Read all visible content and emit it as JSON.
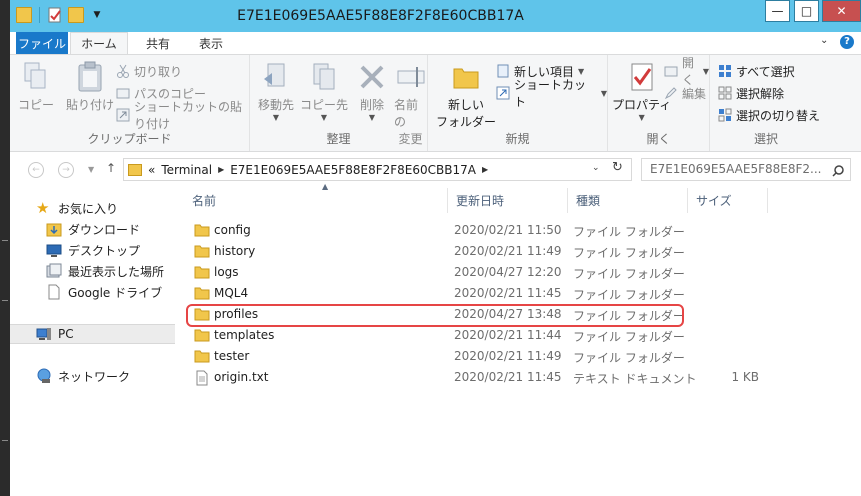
{
  "window": {
    "title": "E7E1E069E5AAE5F88E8F2F8E60CBB17A",
    "min_label": "—",
    "max_label": "□",
    "close_label": "✕"
  },
  "tabs": {
    "file": "ファイル",
    "home": "ホーム",
    "share": "共有",
    "view": "表示"
  },
  "ribbon": {
    "clipboard": {
      "label": "クリップボード",
      "copy": "コピー",
      "paste": "貼り付け",
      "cut": "切り取り",
      "copy_path": "パスのコピー",
      "paste_shortcut": "ショートカットの貼り付け"
    },
    "organize": {
      "label": "整理",
      "move_to": "移動先",
      "copy_to": "コピー先",
      "delete": "削除",
      "rename_line1": "名前の",
      "rename_line2": "変更"
    },
    "new": {
      "label": "新規",
      "new_folder_line1": "新しい",
      "new_folder_line2": "フォルダー",
      "new_item": "新しい項目",
      "shortcut": "ショートカット"
    },
    "open": {
      "label": "開く",
      "properties": "プロパティ",
      "open": "開く",
      "edit": "編集"
    },
    "select": {
      "label": "選択",
      "select_all": "すべて選択",
      "select_none": "選択解除",
      "invert": "選択の切り替え"
    }
  },
  "address": {
    "prefix": "«",
    "crumbs": [
      "Terminal",
      "E7E1E069E5AAE5F88E8F2F8E60CBB17A"
    ],
    "search_placeholder": "E7E1E069E5AAE5F88E8F2..."
  },
  "navpane": {
    "favorites": "お気に入り",
    "downloads": "ダウンロード",
    "desktop": "デスクトップ",
    "recent": "最近表示した場所",
    "gdrive": "Google ドライブ",
    "pc": "PC",
    "network": "ネットワーク"
  },
  "columns": {
    "name": "名前",
    "modified": "更新日時",
    "type": "種類",
    "size": "サイズ"
  },
  "files": [
    {
      "name": "config",
      "modified": "2020/02/21 11:50",
      "type": "ファイル フォルダー",
      "size": "",
      "icon": "folder-icon"
    },
    {
      "name": "history",
      "modified": "2020/02/21 11:49",
      "type": "ファイル フォルダー",
      "size": "",
      "icon": "folder-icon"
    },
    {
      "name": "logs",
      "modified": "2020/04/27 12:20",
      "type": "ファイル フォルダー",
      "size": "",
      "icon": "folder-icon"
    },
    {
      "name": "MQL4",
      "modified": "2020/02/21 11:45",
      "type": "ファイル フォルダー",
      "size": "",
      "icon": "folder-icon"
    },
    {
      "name": "profiles",
      "modified": "2020/04/27 13:48",
      "type": "ファイル フォルダー",
      "size": "",
      "icon": "folder-icon"
    },
    {
      "name": "templates",
      "modified": "2020/02/21 11:44",
      "type": "ファイル フォルダー",
      "size": "",
      "icon": "folder-icon"
    },
    {
      "name": "tester",
      "modified": "2020/02/21 11:49",
      "type": "ファイル フォルダー",
      "size": "",
      "icon": "folder-icon"
    },
    {
      "name": "origin.txt",
      "modified": "2020/02/21 11:45",
      "type": "テキスト ドキュメント",
      "size": "1 KB",
      "icon": "text-file-icon"
    }
  ],
  "colors": {
    "titlebar": "#5fc4ea",
    "file_tab": "#1979ca",
    "folder": "#f1c64b",
    "highlight": "#e64545"
  }
}
